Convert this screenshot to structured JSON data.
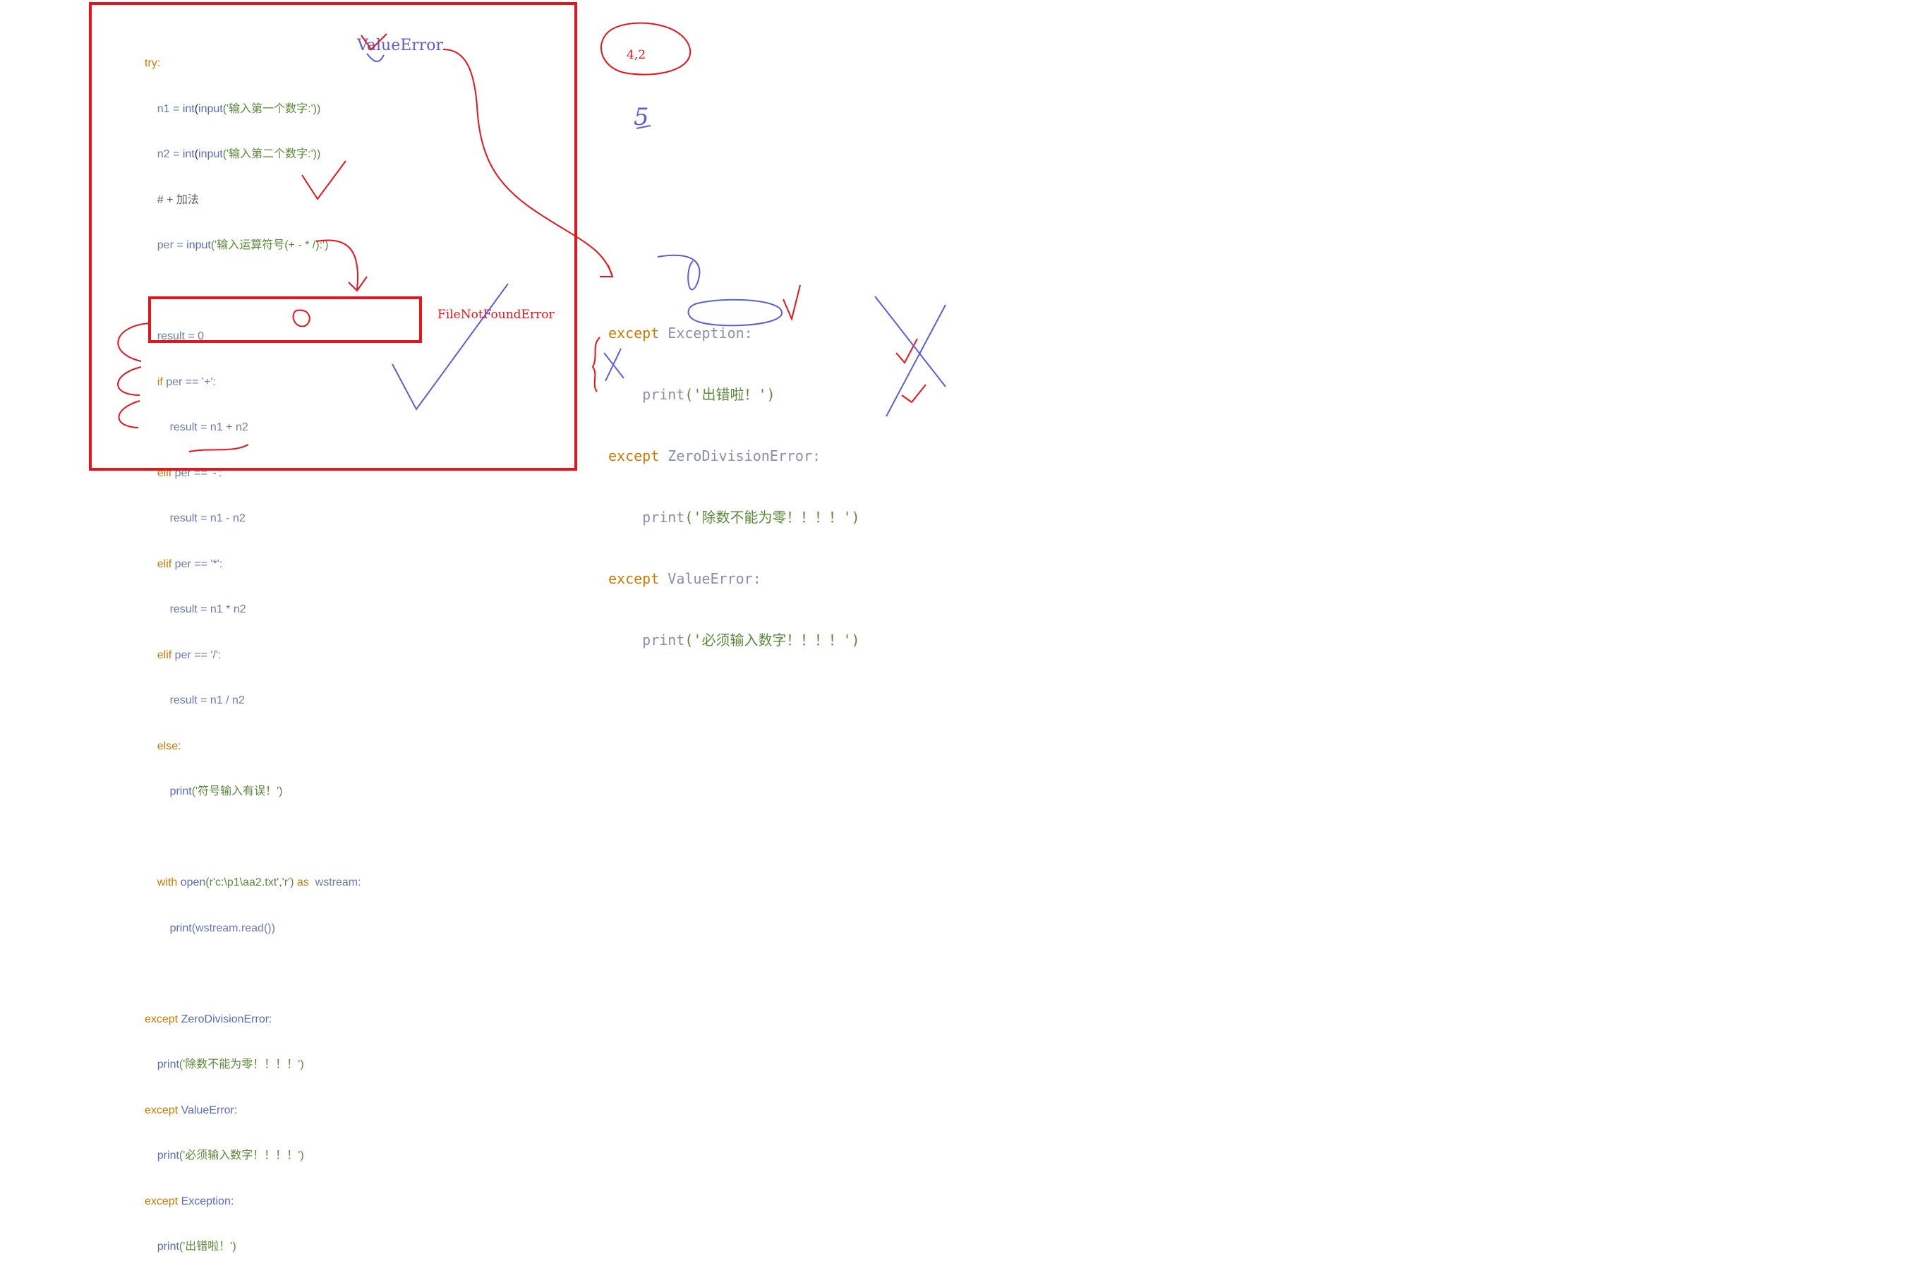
{
  "left_code": {
    "try": "try:",
    "n1_a": "n1 = ",
    "n1_b": "int",
    "n1_c": "(",
    "n1_d": "input",
    "n1_e": "('输入第一个数字:'))",
    "n2_a": "n2 = ",
    "n2_b": "int",
    "n2_c": "(",
    "n2_d": "input",
    "n2_e": "('输入第二个数字:'))",
    "comment": "# + 加法",
    "per_a": "per = ",
    "per_b": "input",
    "per_c": "('输入运算符号(+ - * /):')",
    "result0": "result = 0",
    "if_kw": "if",
    "if_rest": " per == '+':",
    "r_add": "result = n1 + n2",
    "elif1_kw": "elif",
    "elif1_rest": " per == '-':",
    "r_sub": "result = n1 - n2",
    "elif2_kw": "elif",
    "elif2_rest": " per == '*':",
    "r_mul": "result = n1 * n2",
    "elif3_kw": "elif",
    "elif3_rest": " per == '/':",
    "r_div": "result = n1 / n2",
    "else": "else:",
    "print_err_a": "print",
    "print_err_b": "('符号输入有误！')",
    "with_kw": "with",
    "with_open": " open",
    "with_args": "(r'c:\\p1\\aa2.txt','r')",
    "with_as": " as ",
    "with_var": " wstream:",
    "read_a": "print",
    "read_b": "(wstream.read())",
    "exc1_kw": "except",
    "exc1_name": " ZeroDivisionError:",
    "p1_a": "print",
    "p1_b": "('除数不能为零！！！！')",
    "exc2_kw": "except",
    "exc2_name": " ValueError:",
    "p2_a": "print",
    "p2_b": "('必须输入数字！！！！')",
    "exc3_kw": "except",
    "exc3_name": " Exception:",
    "p3_a": "print",
    "p3_b": "('出错啦！')"
  },
  "right_code": {
    "e1_kw": "except",
    "e1_name": " Exception:",
    "e1_print": "print",
    "e1_str": "('出错啦！')",
    "e2_kw": "except",
    "e2_name": " ZeroDivisionError:",
    "e2_print": "print",
    "e2_str": "('除数不能为零！！！！')",
    "e3_kw": "except",
    "e3_name": " ValueError:",
    "e3_print": "print",
    "e3_str": "('必须输入数字！！！！')"
  },
  "annotations": {
    "value_error": "ValueError",
    "file_not_found": "FileNotFoundError",
    "inputs": "4,2",
    "five": "5"
  },
  "colors": {
    "red_ink": "#e8141c",
    "blue_ink": "#5b5fd6",
    "keyword": "#cc7a00",
    "string": "#5b8a3a"
  }
}
